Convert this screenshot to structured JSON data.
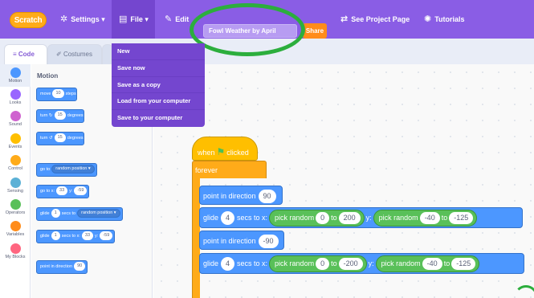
{
  "menubar": {
    "logo": "Scratch",
    "settings": "Settings",
    "file": "File",
    "edit": "Edit",
    "project_title": "Fowl Weather by April",
    "share": "Share",
    "see_project_page": "See Project Page",
    "tutorials": "Tutorials"
  },
  "file_menu": {
    "items": [
      "New",
      "Save now",
      "Save as a copy",
      "Load from your computer",
      "Save to your computer"
    ]
  },
  "tabs": {
    "code": "Code",
    "costumes": "Costumes"
  },
  "categories": [
    "Motion",
    "Looks",
    "Sound",
    "Events",
    "Control",
    "Sensing",
    "Operators",
    "Variables",
    "My Blocks"
  ],
  "category_colors": [
    "#4c97ff",
    "#9966ff",
    "#cf63cf",
    "#ffbf00",
    "#ffab19",
    "#5cb1d6",
    "#59c059",
    "#ff8c1a",
    "#ff6680"
  ],
  "palette": {
    "heading": "Motion",
    "move": {
      "t1": "move",
      "v1": "10",
      "t2": "steps"
    },
    "turn_cw": {
      "t1": "turn",
      "icon": "↻",
      "v1": "15",
      "t2": "degrees"
    },
    "turn_ccw": {
      "t1": "turn",
      "icon": "↺",
      "v1": "15",
      "t2": "degrees"
    },
    "goto": {
      "t1": "go to",
      "v1": "random position ▾"
    },
    "goto_xy": {
      "t1": "go to x:",
      "v1": "33",
      "t2": "y:",
      "v2": "-59"
    },
    "glide_to": {
      "t1": "glide",
      "v1": "1",
      "t2": "secs to",
      "v2": "random position ▾"
    },
    "glide_xy": {
      "t1": "glide",
      "v1": "1",
      "t2": "secs to x:",
      "v2": "33",
      "t3": "y:",
      "v3": "-59"
    },
    "point": {
      "t1": "point in direction",
      "v1": "90"
    }
  },
  "script": {
    "hat": {
      "t1": "when",
      "t2": "clicked"
    },
    "forever": "forever",
    "point1": {
      "t1": "point in direction",
      "v1": "90"
    },
    "glide1": {
      "t1": "glide",
      "v1": "4",
      "t2": "secs to x:",
      "r1": "pick random",
      "a1": "0",
      "to1": "to",
      "b1": "200",
      "t3": "y:",
      "r2": "pick random",
      "a2": "-40",
      "to2": "to",
      "b2": "-125"
    },
    "point2": {
      "t1": "point in direction",
      "v1": "-90"
    },
    "glide2": {
      "t1": "glide",
      "v1": "4",
      "t2": "secs to x:",
      "r1": "pick random",
      "a1": "0",
      "to1": "to",
      "b1": "-200",
      "t3": "y:",
      "r2": "pick random",
      "a2": "-40",
      "to2": "to",
      "b2": "-125"
    }
  },
  "colors": {
    "menubar": "#8a5de5",
    "motion": "#4c97ff",
    "events": "#ffbf00",
    "control": "#ffab19",
    "operators": "#59c059",
    "highlight": "#2cae3d"
  }
}
